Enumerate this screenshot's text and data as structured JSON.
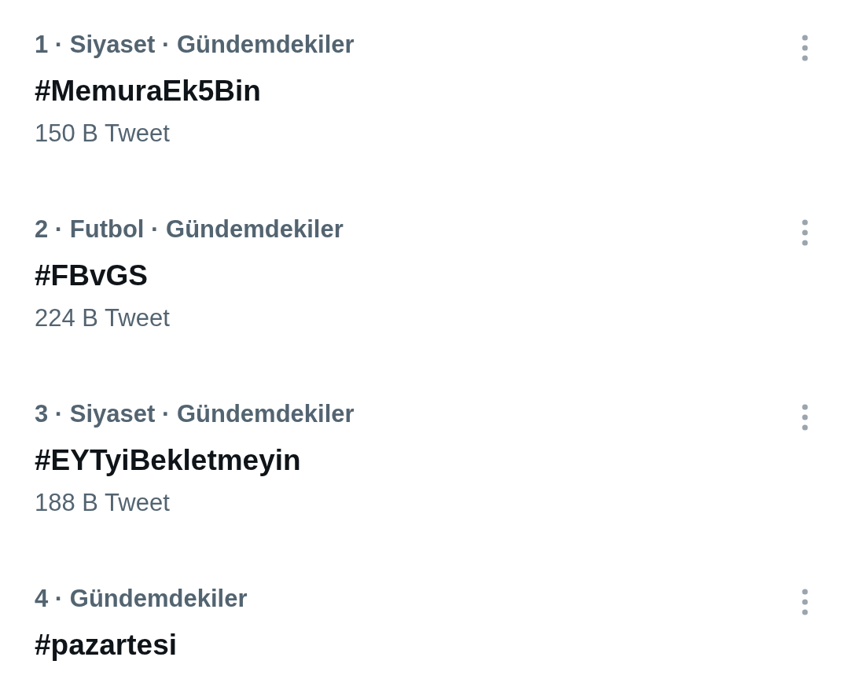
{
  "trends": [
    {
      "context": "1 · Siyaset · Gündemdekiler",
      "name": "#MemuraEk5Bin",
      "count": "150 B Tweet"
    },
    {
      "context": "2 · Futbol · Gündemdekiler",
      "name": "#FBvGS",
      "count": "224 B Tweet"
    },
    {
      "context": "3 · Siyaset · Gündemdekiler",
      "name": "#EYTyiBekletmeyin",
      "count": "188 B Tweet"
    },
    {
      "context": "4 · Gündemdekiler",
      "name": "#pazartesi"
    }
  ]
}
